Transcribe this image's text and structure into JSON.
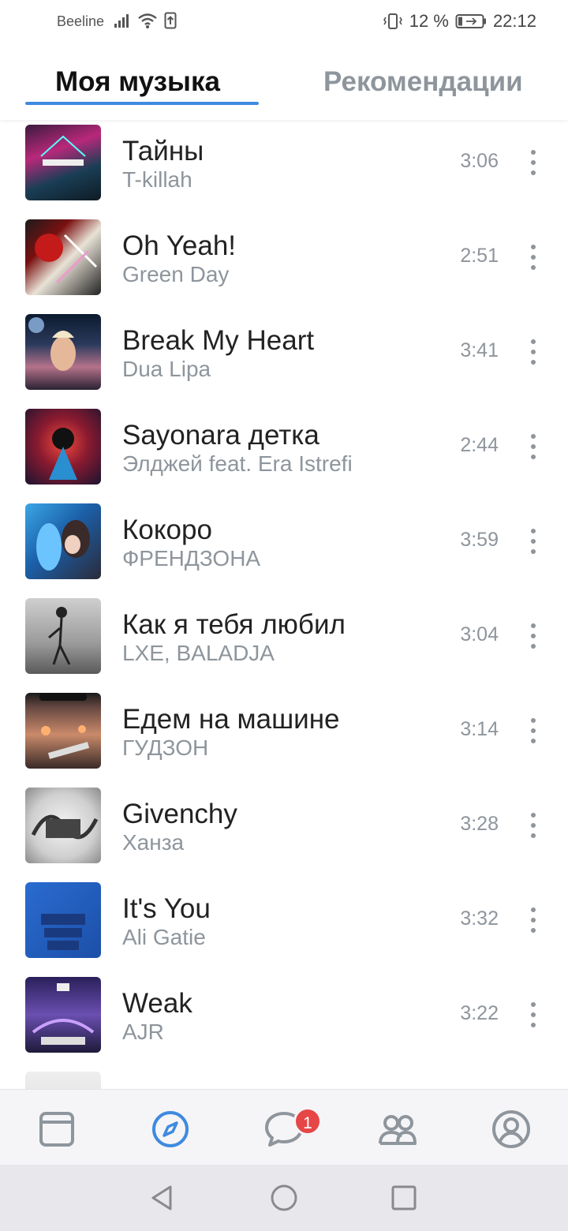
{
  "status_bar": {
    "carrier": "Beeline",
    "battery": "12 %",
    "time": "22:12",
    "icons": [
      "signal-icon",
      "wifi-icon",
      "upload-icon",
      "vibrate-icon",
      "battery-icon"
    ]
  },
  "tabs": [
    {
      "label": "Моя музыка",
      "active": true
    },
    {
      "label": "Рекомендации",
      "active": false
    }
  ],
  "tracks": [
    {
      "title": "Тайны",
      "artist": "T-killah",
      "duration": "3:06"
    },
    {
      "title": "Oh Yeah!",
      "artist": "Green Day",
      "duration": "2:51"
    },
    {
      "title": "Break My Heart",
      "artist": "Dua Lipa",
      "duration": "3:41"
    },
    {
      "title": "Sayonara детка",
      "artist": "Элджей feat. Era Istrefi",
      "duration": "2:44"
    },
    {
      "title": "Кокоро",
      "artist": "ФРЕНДЗОНА",
      "duration": "3:59"
    },
    {
      "title": "Как я тебя любил",
      "artist": "LXE, BALADJA",
      "duration": "3:04"
    },
    {
      "title": "Едем на машине",
      "artist": "ГУДЗОН",
      "duration": "3:14"
    },
    {
      "title": "Givenchy",
      "artist": "Ханза",
      "duration": "3:28"
    },
    {
      "title": "It's You",
      "artist": "Ali Gatie",
      "duration": "3:32"
    },
    {
      "title": "Weak",
      "artist": "AJR",
      "duration": "3:22"
    },
    {
      "title": "",
      "artist": "",
      "duration": ""
    }
  ],
  "bottom_nav": {
    "items": [
      "news-icon",
      "explore-icon",
      "messages-icon",
      "friends-icon",
      "profile-icon"
    ],
    "active": "explore-icon",
    "messages_badge": "1"
  },
  "system_nav": [
    "back-icon",
    "home-icon",
    "recents-icon"
  ],
  "colors": {
    "accent": "#3f8ae0",
    "secondary_text": "#8e959c",
    "badge": "#e64646"
  }
}
